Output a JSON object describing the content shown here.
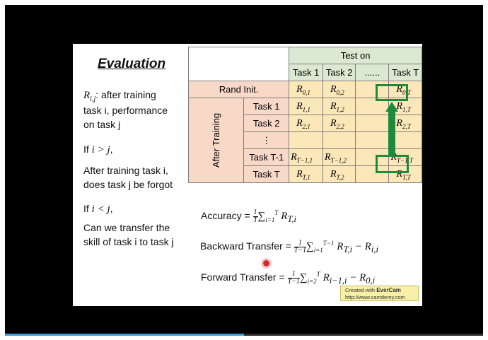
{
  "player": {
    "progress": 0.5
  },
  "slide": {
    "title": "Evaluation",
    "definition": {
      "var": "R",
      "sub": "i,j",
      "rest": ": after training",
      "line2": "task i, performance",
      "line3": "on task j"
    },
    "cond1": {
      "prefix": "If ",
      "expr": "i > j",
      "suffix": ","
    },
    "cond1_desc": [
      "After training task i,",
      "does task j be forgot"
    ],
    "cond2": {
      "prefix": "If ",
      "expr": "i < j",
      "suffix": ","
    },
    "cond2_desc": [
      "Can we transfer the",
      "skill of task i to task j"
    ]
  },
  "table": {
    "test_on": "Test on",
    "col_headers": [
      "Task 1",
      "Task 2",
      "......",
      "Task T"
    ],
    "row_group_label": "After Training",
    "rows": [
      {
        "label": "Rand Init.",
        "cells": [
          [
            "R",
            "0,1"
          ],
          [
            "R",
            "0,2"
          ],
          [
            "",
            ""
          ],
          [
            "R",
            "0,T"
          ]
        ]
      },
      {
        "label": "Task 1",
        "cells": [
          [
            "R",
            "1,1"
          ],
          [
            "R",
            "1,2"
          ],
          [
            "",
            ""
          ],
          [
            "R",
            "1,T"
          ]
        ]
      },
      {
        "label": "Task 2",
        "cells": [
          [
            "R",
            "2,1"
          ],
          [
            "R",
            "2,2"
          ],
          [
            "",
            ""
          ],
          [
            "R",
            "2,T"
          ]
        ]
      },
      {
        "label": "⋮",
        "cells": [
          [
            "",
            ""
          ],
          [
            "",
            ""
          ],
          [
            "",
            ""
          ],
          [
            "",
            ""
          ]
        ]
      },
      {
        "label": "Task T-1",
        "cells": [
          [
            "R",
            "T−1,1"
          ],
          [
            "R",
            "T−1,2"
          ],
          [
            "",
            ""
          ],
          [
            "R",
            "T−1,T"
          ]
        ]
      },
      {
        "label": "Task T",
        "cells": [
          [
            "R",
            "T,1"
          ],
          [
            "R",
            "T,2"
          ],
          [
            "",
            ""
          ],
          [
            "R",
            "T,T"
          ]
        ]
      }
    ]
  },
  "formulas": {
    "accuracy": {
      "label": "Accuracy",
      "frac_num": "1",
      "frac_den": "T",
      "sum_sub": "i=1",
      "sum_sup": "T",
      "term": "R",
      "term_sub": "T,i",
      "tail": "",
      "tail_sub": ""
    },
    "backward": {
      "label": "Backward Transfer",
      "frac_num": "1",
      "frac_den": "T−1",
      "sum_sub": "i=1",
      "sum_sup": "T−1",
      "term": "R",
      "term_sub": "T,i",
      "tail": " − R",
      "tail_sub": "i,i"
    },
    "forward": {
      "label": "Forward Transfer",
      "frac_num": "1",
      "frac_den": "T−1",
      "sum_sub": "i=2",
      "sum_sup": "T",
      "term": "R",
      "term_sub": "i−1,i",
      "tail": " − R",
      "tail_sub": "0,i"
    }
  },
  "watermark": {
    "line1_prefix": "Created with ",
    "line1_brand": "EverCam",
    "line2": "http://www.camdemy.com"
  },
  "colors": {
    "header_green": "#dbe9d2",
    "row_peach": "#f8d9c8",
    "cell_yellow": "#fce7b9",
    "highlight": "#1f8a3c",
    "cursor": "#d62b2b"
  }
}
